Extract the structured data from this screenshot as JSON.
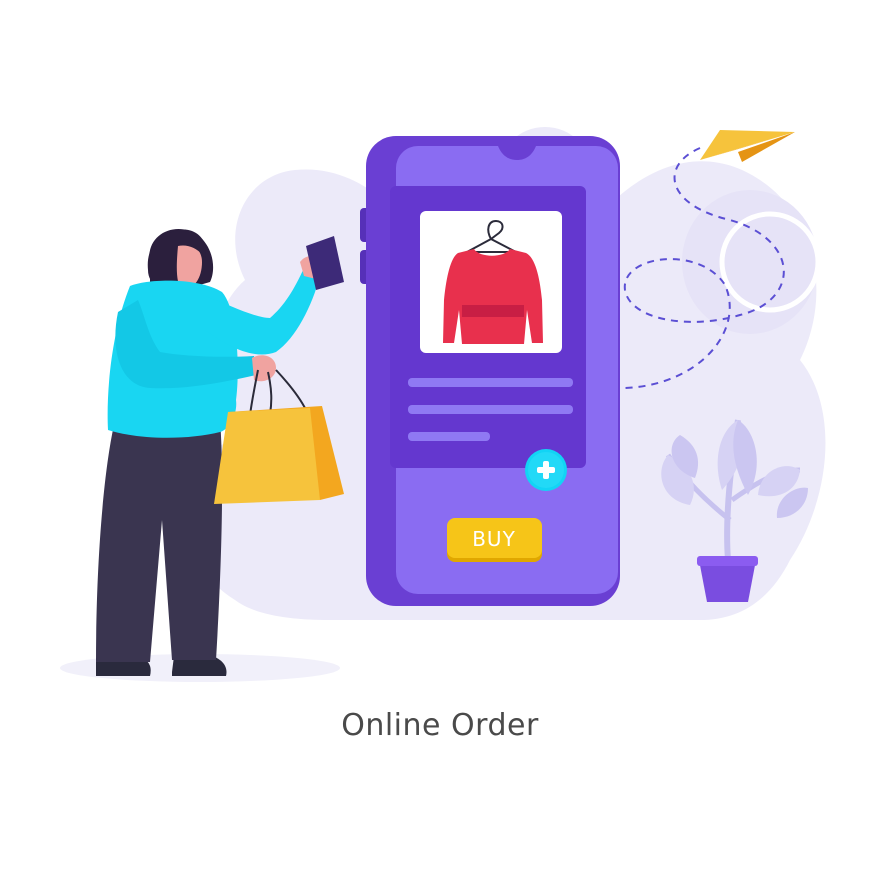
{
  "illustration": {
    "caption": "Online Order",
    "buy_button_label": "BUY",
    "icons": [
      "shopper-woman-icon",
      "smartphone-icon",
      "shopping-bag-icon",
      "sweater-hanger-icon",
      "plus-icon",
      "paper-plane-icon",
      "potted-plant-icon"
    ],
    "colors": {
      "phone_purple": "#6a3fd3",
      "phone_screen": "#8a6cf2",
      "card_purple": "#6437cf",
      "sweater_red": "#e8304d",
      "plus_cyan": "#12d4f5",
      "buy_yellow": "#f6c518",
      "sweater_blue": "#19d6f2",
      "bag_yellow": "#f6c33c",
      "plane_yellow": "#f6c33c",
      "blob_lavender": "#eceaf9"
    }
  }
}
